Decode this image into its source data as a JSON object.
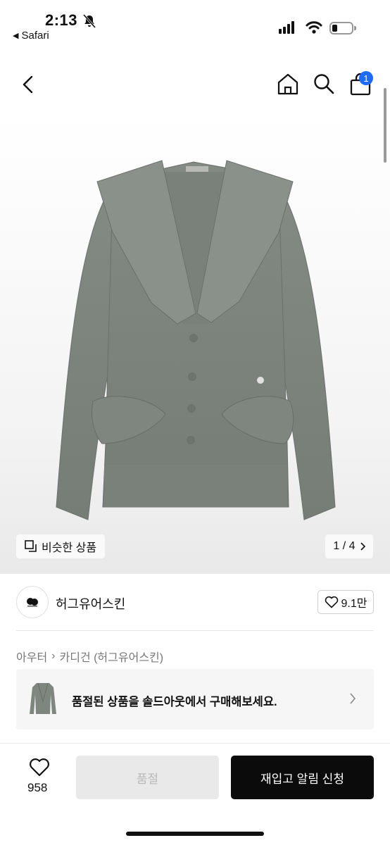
{
  "status_bar": {
    "time": "2:13",
    "back_app": "Safari"
  },
  "nav": {
    "cart_count": "1"
  },
  "gallery": {
    "similar_label": "비슷한 상품",
    "counter": "1 / 4"
  },
  "brand": {
    "name": "허그유어스킨",
    "likes": "9.1만"
  },
  "breadcrumbs": [
    "아우터",
    "카디건 (허그유어스킨)"
  ],
  "soldout_banner": {
    "text": "품절된 상품을 솔드아웃에서 구매해보세요."
  },
  "bottom_bar": {
    "like_count": "958",
    "soldout_label": "품절",
    "restock_label": "재입고 알림 신청"
  },
  "colors": {
    "accent_badge": "#1f6bff",
    "primary_button": "#0b0b0b",
    "garment": "#7d837d"
  }
}
